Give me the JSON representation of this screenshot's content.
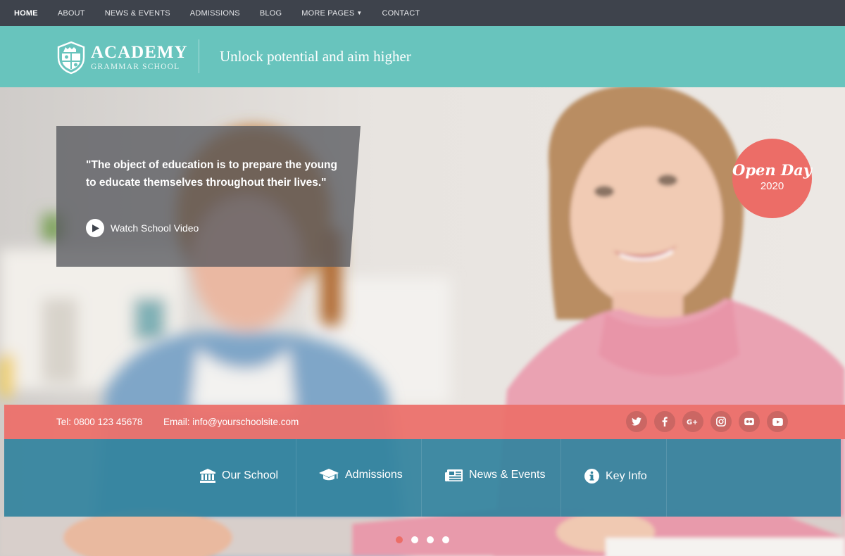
{
  "nav": {
    "items": [
      {
        "label": "HOME",
        "active": true
      },
      {
        "label": "ABOUT"
      },
      {
        "label": "NEWS & EVENTS"
      },
      {
        "label": "ADMISSIONS"
      },
      {
        "label": "BLOG"
      },
      {
        "label": "MORE PAGES",
        "has_dropdown": true
      },
      {
        "label": "CONTACT"
      }
    ]
  },
  "header": {
    "logo_title": "ACADEMY",
    "logo_subtitle": "GRAMMAR SCHOOL",
    "tagline": "Unlock potential and aim higher"
  },
  "hero": {
    "quote": "\"The object of education is to prepare the young to educate themselves throughout their lives.\"",
    "watch_label": "Watch School Video",
    "open_day_title": "Open Day",
    "open_day_year": "2020"
  },
  "contact": {
    "tel": "Tel: 0800 123 45678",
    "email": "Email: info@yourschoolsite.com",
    "social_icons": [
      "twitter-icon",
      "facebook-icon",
      "google-plus-icon",
      "instagram-icon",
      "flickr-icon",
      "youtube-icon"
    ]
  },
  "quick_links": [
    {
      "label": "Our School",
      "icon": "bank-icon"
    },
    {
      "label": "Admissions",
      "icon": "graduation-cap-icon"
    },
    {
      "label": "News & Events",
      "icon": "newspaper-icon"
    },
    {
      "label": "Key Info",
      "icon": "info-icon"
    }
  ],
  "slider": {
    "slides": 4,
    "active_index": 0
  },
  "colors": {
    "nav_bg": "#3e434c",
    "header_teal": "#68c4bd",
    "coral": "#ec6d67",
    "links_blue": "#33839e"
  }
}
